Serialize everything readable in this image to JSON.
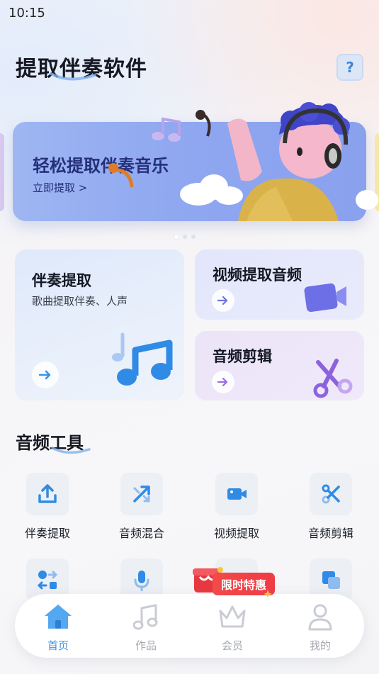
{
  "status_bar": {
    "time": "10:15"
  },
  "header": {
    "title": "提取伴奏软件",
    "help_label": "?"
  },
  "banner": {
    "title": "轻松提取伴奏音乐",
    "link": "立即提取 >"
  },
  "features": {
    "main": {
      "title": "伴奏提取",
      "subtitle": "歌曲提取伴奏、人声"
    },
    "video": {
      "title": "视频提取音频"
    },
    "edit": {
      "title": "音频剪辑"
    }
  },
  "tools": {
    "title": "音频工具",
    "items": [
      {
        "label": "伴奏提取",
        "icon": "upload-icon"
      },
      {
        "label": "音频混合",
        "icon": "shuffle-icon"
      },
      {
        "label": "视频提取",
        "icon": "video-camera-icon"
      },
      {
        "label": "音频剪辑",
        "icon": "scissors-icon"
      }
    ]
  },
  "promo": {
    "label": "限时特惠"
  },
  "bottom_nav": {
    "items": [
      {
        "label": "首页",
        "icon": "home-icon",
        "active": true
      },
      {
        "label": "作品",
        "icon": "music-note-icon",
        "active": false
      },
      {
        "label": "会员",
        "icon": "crown-icon",
        "active": false
      },
      {
        "label": "我的",
        "icon": "user-icon",
        "active": false
      }
    ]
  },
  "colors": {
    "accent": "#3b93e6",
    "banner": "#8fa8f0",
    "banner_text": "#25307a",
    "promo": "#ef3b45",
    "inactive": "#a4a8b0"
  }
}
